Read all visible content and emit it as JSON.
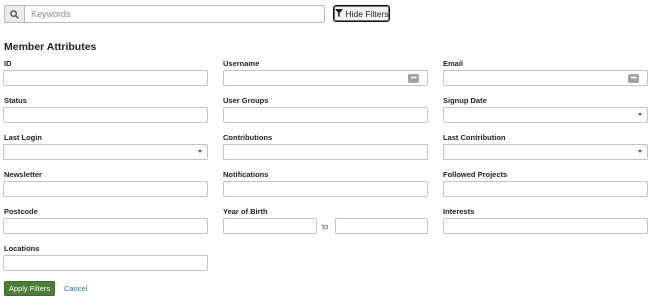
{
  "search": {
    "placeholder": "Keywords",
    "value": "",
    "hide_filters_label": "Hide Filters"
  },
  "section_title": "Member Attributes",
  "fields": {
    "id": {
      "label": "ID",
      "value": ""
    },
    "username": {
      "label": "Username",
      "value": "",
      "icon": "dots-icon"
    },
    "email": {
      "label": "Email",
      "value": "",
      "icon": "dots-icon"
    },
    "status": {
      "label": "Status",
      "value": ""
    },
    "user_groups": {
      "label": "User Groups",
      "value": ""
    },
    "signup_date": {
      "label": "Signup Date",
      "value": "",
      "icon": "caret-down-icon"
    },
    "last_login": {
      "label": "Last Login",
      "value": "",
      "icon": "caret-down-icon"
    },
    "contributions": {
      "label": "Contributions",
      "value": ""
    },
    "last_contribution": {
      "label": "Last Contribution",
      "value": "",
      "icon": "caret-down-icon"
    },
    "newsletter": {
      "label": "Newsletter",
      "value": ""
    },
    "notifications": {
      "label": "Notifications",
      "value": ""
    },
    "followed_projects": {
      "label": "Followed Projects",
      "value": ""
    },
    "postcode": {
      "label": "Postcode",
      "value": ""
    },
    "year_of_birth": {
      "label": "Year of Birth",
      "from": "",
      "to": "",
      "range_separator": "to"
    },
    "interests": {
      "label": "Interests",
      "value": ""
    },
    "locations": {
      "label": "Locations",
      "value": ""
    }
  },
  "actions": {
    "apply_label": "Apply Filters",
    "cancel_label": "Cancel"
  },
  "colors": {
    "apply_button": "#4d7c3a",
    "cancel_link": "#3a6db5",
    "input_border": "#c4c4c4"
  }
}
